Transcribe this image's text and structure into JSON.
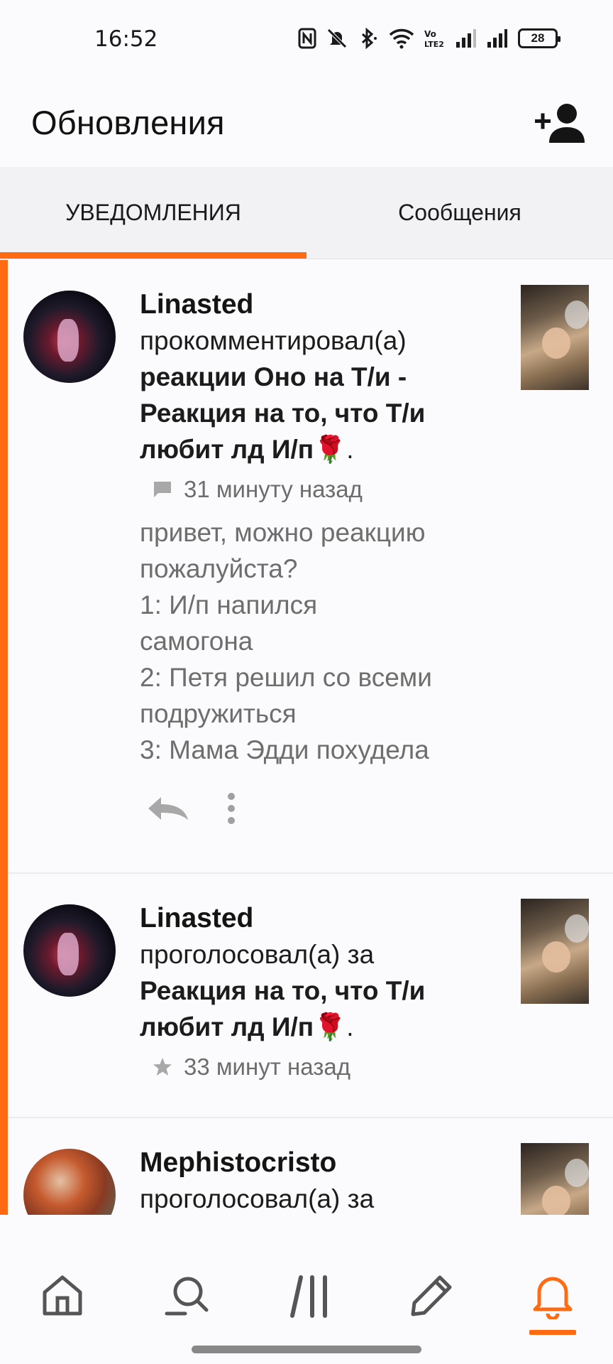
{
  "status_bar": {
    "time": "16:52",
    "battery": "28",
    "icons": [
      "nfc-icon",
      "mute-icon",
      "bluetooth-icon",
      "wifi-icon",
      "volte-icon",
      "signal-icon",
      "signal-icon",
      "battery-icon"
    ]
  },
  "header": {
    "title": "Обновления",
    "action_icon": "add-user-icon"
  },
  "tabs": [
    {
      "label": "УВЕДОМЛЕНИЯ",
      "active": true
    },
    {
      "label": "Сообщения",
      "active": false
    }
  ],
  "accent_color": "#ff6a12",
  "notifications": [
    {
      "user": "Linasted",
      "action": "прокомментировал(а)",
      "target_lines": [
        "реакции Оно на Т/и -",
        "Реакция на то, что Т/и",
        "любит лд И/п🌹"
      ],
      "target_suffix": ".",
      "meta_icon": "comment-icon",
      "time": "31 минуту назад",
      "comment_lines": [
        "привет, можно реакцию",
        "пожалуйста?",
        "1: И/п напился",
        "самогона",
        "2: Петя решил со всеми",
        "подружиться",
        "3: Мама Эдди похудела"
      ],
      "actions": [
        "reply-icon",
        "more-vert-icon"
      ]
    },
    {
      "user": "Linasted",
      "action": "проголосовал(а) за",
      "target_lines": [
        "Реакция на то, что Т/и",
        "любит лд И/п🌹"
      ],
      "target_suffix": ".",
      "meta_icon": "star-icon",
      "time": "33 минут назад"
    },
    {
      "user": "Mephistocristo",
      "action": "проголосовал(а) за"
    }
  ],
  "bottom_nav": [
    {
      "icon": "home-icon",
      "active": false
    },
    {
      "icon": "search-icon",
      "active": false
    },
    {
      "icon": "library-icon",
      "active": false
    },
    {
      "icon": "pencil-icon",
      "active": false
    },
    {
      "icon": "bell-icon",
      "active": true
    }
  ]
}
